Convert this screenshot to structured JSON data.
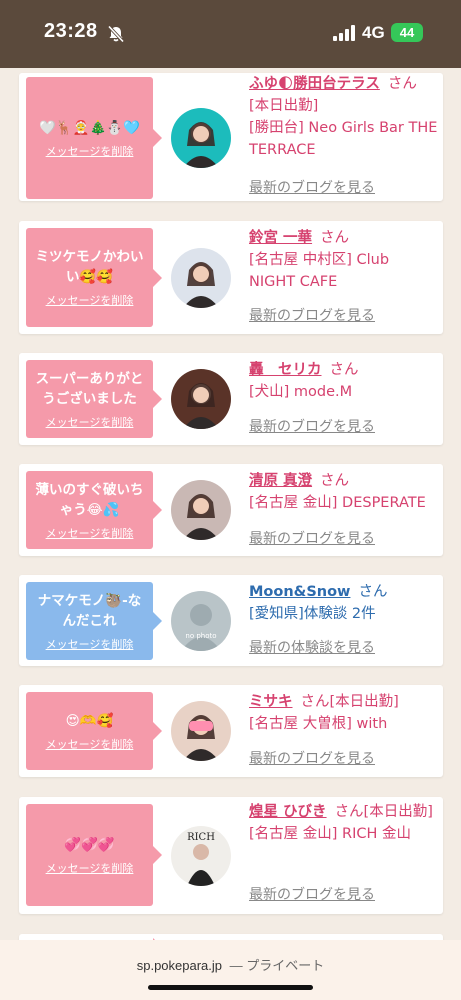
{
  "status_bar": {
    "time": "23:28",
    "network": "4G",
    "battery": "44"
  },
  "cards": [
    {
      "message": "🤍🦌🤶🎄⛄🩵",
      "delete_label": "メッセージを削除",
      "bubble_color": "#f59aaa",
      "name": "ふゆ🌓勝田台テラス",
      "san": "さん",
      "lines": [
        "[本日出勤]",
        "[勝田台] Neo Girls Bar THE TERRACE"
      ],
      "link": "最新のブログを見る",
      "avatar_color": "#1cbcbc"
    },
    {
      "message": "ミツケモノかわいい🥰🥰",
      "delete_label": "メッセージを削除",
      "bubble_color": "#f59aaa",
      "name": "鈴宮 一華",
      "san": "さん",
      "lines": [
        "[名古屋 中村区] Club NIGHT CAFE"
      ],
      "link": "最新のブログを見る",
      "avatar_color": "#dde3ec"
    },
    {
      "message": "スーパーありがとうございました",
      "delete_label": "メッセージを削除",
      "bubble_color": "#f59aaa",
      "name": "轟　セリカ",
      "san": "さん",
      "lines": [
        "[犬山] mode.M"
      ],
      "link": "最新のブログを見る",
      "avatar_color": "#5a3328"
    },
    {
      "message": "薄いのすぐ破いちゃう😂💦",
      "delete_label": "メッセージを削除",
      "bubble_color": "#f59aaa",
      "name": "清原 真澄",
      "san": "さん",
      "lines": [
        "[名古屋 金山] DESPERATE"
      ],
      "link": "最新のブログを見る",
      "avatar_color": "#c9b8b4"
    },
    {
      "message": "ナマケモノ🦥-なんだこれ",
      "delete_label": "メッセージを削除",
      "bubble_color": "#8ab9ec",
      "name": "Moon&Snow",
      "san": "さん",
      "lines": [
        "[愛知県]体験談 2件"
      ],
      "link": "最新の体験談を見る",
      "avatar_color": "#b9c4c8",
      "avatar_text": "no photo"
    },
    {
      "message": "😍🫶🥰",
      "delete_label": "メッセージを削除",
      "bubble_color": "#f59aaa",
      "name": "ミサキ",
      "san": "さん[本日出勤]",
      "lines": [
        "[名古屋 大曽根] with"
      ],
      "link": "最新のブログを見る",
      "avatar_color": "#e8d2c6"
    },
    {
      "message": "💞💞💞",
      "delete_label": "メッセージを削除",
      "bubble_color": "#f59aaa",
      "name": "煌星 ひびき",
      "san": "さん[本日出勤]",
      "lines": [
        "[名古屋 金山] RICH 金山"
      ],
      "link": "最新のブログを見る",
      "avatar_color": "#f0eeea",
      "avatar_text": "RICH"
    }
  ],
  "footer": {
    "domain": "sp.pokepara.jp",
    "mode": "— プライベート"
  }
}
